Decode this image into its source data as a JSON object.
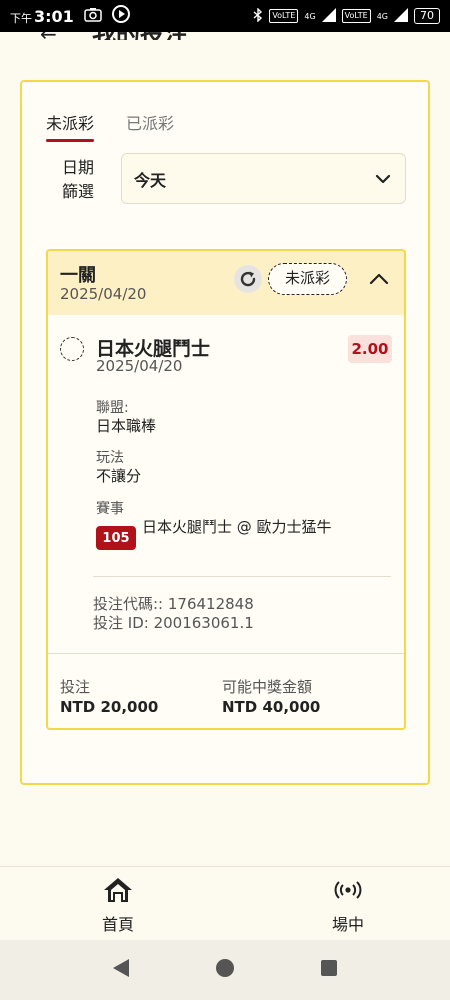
{
  "status_bar": {
    "ampm": "下午",
    "time": "3:01",
    "network1": "VoLTE",
    "network2": "VoLTE",
    "signal1": "4G",
    "signal2": "4G",
    "battery": "70"
  },
  "header": {
    "title": "我的投注"
  },
  "tabs": [
    {
      "label": "未派彩",
      "active": true
    },
    {
      "label": "已派彩",
      "active": false
    }
  ],
  "filter": {
    "label": "日期\n篩選",
    "selected": "今天"
  },
  "bet": {
    "type": "一關",
    "date": "2025/04/20",
    "status": "未派彩",
    "selection": {
      "name": "日本火腿鬥士",
      "date": "2025/04/20",
      "odds": "2.00"
    },
    "league_label": "聯盟:",
    "league": "日本職棒",
    "market_label": "玩法",
    "market": "不讓分",
    "event_label": "賽事",
    "event_id": "105",
    "event_name": "日本火腿鬥士 @ 歐力士猛牛",
    "bet_code": "投注代碼:: 176412848",
    "bet_id": "投注 ID: 200163061.1",
    "stake_label": "投注",
    "stake": "NTD 20,000",
    "payout_label": "可能中獎金額",
    "payout": "NTD 40,000"
  },
  "bottom_nav": [
    {
      "label": "首頁",
      "icon": "home-icon"
    },
    {
      "label": "場中",
      "icon": "live-icon"
    }
  ],
  "colors": {
    "accent": "#b0121a",
    "border": "#f2d94a",
    "card_header": "#fdf0c4"
  }
}
